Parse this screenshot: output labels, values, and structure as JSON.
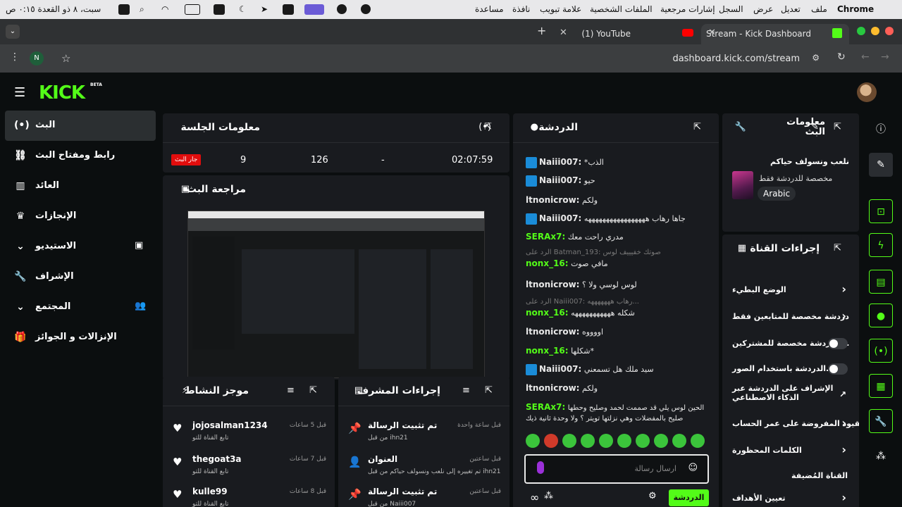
{
  "menubar": {
    "app": "Chrome",
    "items": [
      "ملف",
      "تعديل",
      "عرض",
      "السجل",
      "إشارات مرجعية",
      "الملفات الشخصية",
      "علامة تبويب",
      "نافذة",
      "مساعدة"
    ],
    "clock": "سبت، ٨ ذو القعدة ٠:١٥ ص"
  },
  "browser": {
    "tabs": [
      {
        "label": "Stream - Kick Dashboard",
        "active": true
      },
      {
        "label": "(1) YouTube",
        "active": false
      }
    ],
    "url": "dashboard.kick.com/stream",
    "profile_initial": "N"
  },
  "kick": {
    "logo": "KICK",
    "beta": "BETA",
    "nav": [
      {
        "label": "البث",
        "icon": "broadcast-icon",
        "active": true
      },
      {
        "label": "رابط ومفتاح البث",
        "icon": "link-icon"
      },
      {
        "label": "العائد",
        "icon": "chart-icon"
      },
      {
        "label": "الإنجازات",
        "icon": "trophy-icon"
      },
      {
        "label": "الاستيديو",
        "icon": "film-icon",
        "expandable": true
      },
      {
        "label": "الإشراف",
        "icon": "wrench-icon"
      },
      {
        "label": "المجتمع",
        "icon": "users-icon",
        "expandable": true
      },
      {
        "label": "الإنزالات و الجوائز",
        "icon": "gift-icon"
      }
    ],
    "session": {
      "title": "معلومات الجلسة",
      "live_label": "جار البث",
      "stats": [
        "9",
        "126",
        "-",
        "02:07:59"
      ]
    },
    "preview": {
      "title": "مراجعة البث"
    },
    "chat": {
      "title": "الدردشة",
      "messages": [
        {
          "user": "Naiii007:",
          "text": "*الذب",
          "badge": true
        },
        {
          "user": "Naiii007:",
          "text": "حيو",
          "badge": true
        },
        {
          "user": "ltnonicrow:",
          "text": "ولكم"
        },
        {
          "user": "Naiii007:",
          "text": "جاها رهاب هههههههههههههههههه",
          "badge": true
        },
        {
          "user": "SERAx7:",
          "text": "مدري راحت معك",
          "green": true
        },
        {
          "reply": "الرد على Batman_193: صوتك خفيييف لوس",
          "user": "nonx_16:",
          "text": "مافي صوت",
          "green": true
        },
        {
          "user": "ltnonicrow:",
          "text": "لوس لوسي ولا ؟"
        },
        {
          "reply": "الرد على Naiii007: رهاب هههههههه...",
          "user": "nonx_16:",
          "text": "شكله هههههههههههه",
          "green": true
        },
        {
          "user": "ltnonicrow:",
          "text": "اووووه"
        },
        {
          "user": "nonx_16:",
          "text": "شكلها*",
          "green": true
        },
        {
          "user": "Naiii007:",
          "text": "سيد ملك هل تسمعني",
          "badge": true
        },
        {
          "user": "ltnonicrow:",
          "text": "ولكم"
        },
        {
          "user": "SERAx7:",
          "text": "الحين لوس يلي قد صممت لحمد وصليح وحطها",
          "green": true
        },
        {
          "text": "صليح بالمفضلات وهي نزلتها تويتر ؟ ولا وحدة ثانية ذيك"
        }
      ],
      "input_placeholder": "ارسال رسالة",
      "send_label": "الدردشة"
    },
    "stream_info": {
      "title": "معلومات البث",
      "stream_title": "نلعب ونسولف حياكم",
      "category": "مخصصة للدردشة فقط",
      "language": "Arabic"
    },
    "channel_actions": {
      "title": "إجراءات القناة",
      "rows": [
        {
          "label": "الوضع البطيء",
          "kind": "arrow"
        },
        {
          "label": "دردشة مخصصة للمتابعين فقط",
          "kind": "arrow"
        },
        {
          "label": "الدردشة مخصصة للمشتركين...",
          "kind": "toggle"
        },
        {
          "label": "الدردشة باستخدام الصور...",
          "kind": "toggle"
        },
        {
          "label": "الإشراف على الدردشة عبر الذكاء الاصطناعي",
          "kind": "ext"
        },
        {
          "label": "القيود المفروضة على عمر الحساب",
          "kind": "arrow"
        },
        {
          "label": "الكلمات المحظورة",
          "kind": "arrow"
        },
        {
          "label": "القناة المُضيفة",
          "kind": "none"
        },
        {
          "label": "تعيين الأهداف",
          "kind": "arrow"
        }
      ]
    },
    "activity": {
      "title": "موجز النشاط",
      "items": [
        {
          "name": "jojosalman1234",
          "sub": "تابع القناة للتو",
          "time": "قبل 5 ساعات"
        },
        {
          "name": "thegoat3a",
          "sub": "تابع القناة للتو",
          "time": "قبل 7 ساعات"
        },
        {
          "name": "kulle99",
          "sub": "تابع القناة للتو",
          "time": "قبل 8 ساعات"
        }
      ]
    },
    "mod_actions": {
      "title": "إجراءات المشرف",
      "items": [
        {
          "name": "تم تثبيت الرسالة",
          "sub": "من قبل ihn21",
          "time": "قبل ساعة واحدة",
          "icon": "pin-icon"
        },
        {
          "name": "العنوان",
          "sub": "تم تغييره إلى نلعب ونسولف حياكم من قبل ihn21",
          "time": "قبل ساعتين",
          "icon": "user-edit-icon"
        },
        {
          "name": "تم تثبيت الرسالة",
          "sub": "من قبل Naiii007",
          "time": "قبل ساعتين",
          "icon": "pin-icon"
        }
      ]
    }
  }
}
